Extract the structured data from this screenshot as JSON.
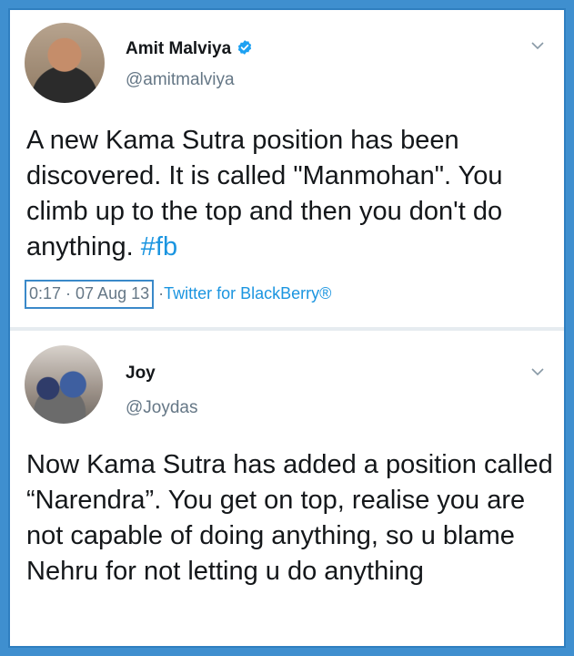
{
  "tweets": [
    {
      "display_name": "Amit Malviya",
      "verified": true,
      "handle": "@amitmalviya",
      "text_main": "A new Kama Sutra position has been discovered. It is called \"Manmohan\". You climb up to the top and then you don't do anything.",
      "hashtag": "#fb",
      "time": "0:17 · 07 Aug 13",
      "separator": "·",
      "source": "Twitter for BlackBerry®"
    },
    {
      "display_name": "Joy",
      "verified": false,
      "handle": "@Joydas",
      "text_main": "Now Kama Sutra has added a position called “Narendra”. You get on top, realise you are not capable of doing anything, so u blame Nehru for not letting u do anything"
    }
  ],
  "colors": {
    "frame_background": "#3f8fcf",
    "link": "#1b95e0",
    "secondary_text": "#657786",
    "verified_badge": "#1da1f2"
  },
  "icons": {
    "verified": "verified-badge-icon",
    "menu": "chevron-down-icon"
  }
}
